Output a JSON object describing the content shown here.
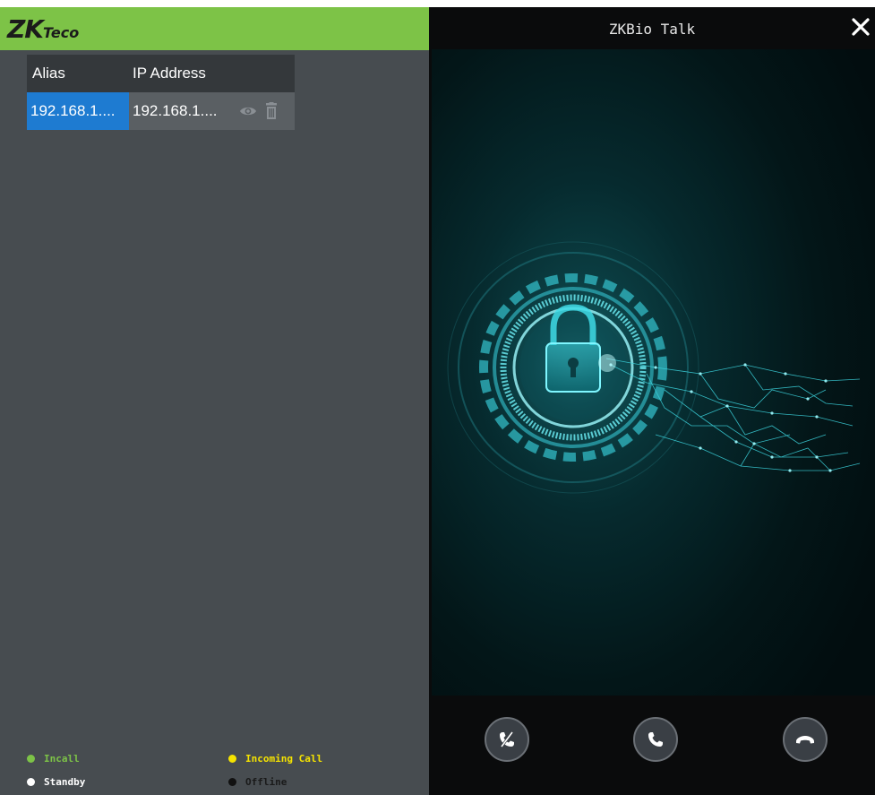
{
  "app": {
    "logo_main": "ZK",
    "logo_sub": "Teco",
    "title": "ZKBio Talk"
  },
  "device_table": {
    "headers": {
      "alias": "Alias",
      "ip": "IP Address"
    },
    "rows": [
      {
        "alias": "192.168.1....",
        "ip": "192.168.1...."
      }
    ]
  },
  "legend": {
    "incall": {
      "label": "Incall",
      "color": "#7dc347"
    },
    "incoming": {
      "label": "Incoming Call",
      "color": "#f5e300"
    },
    "standby": {
      "label": "Standby",
      "color": "#ffffff"
    },
    "offline": {
      "label": "Offline",
      "color": "#111111"
    }
  },
  "icons": {
    "close": "close-icon",
    "view": "eye-icon",
    "delete": "trash-icon",
    "mute": "mute-call-icon",
    "answer": "phone-icon",
    "hangup": "hangup-icon"
  },
  "colors": {
    "logo_bar": "#7dc347",
    "selected_cell": "#1e7bd1",
    "panel_bg": "#474c50"
  }
}
